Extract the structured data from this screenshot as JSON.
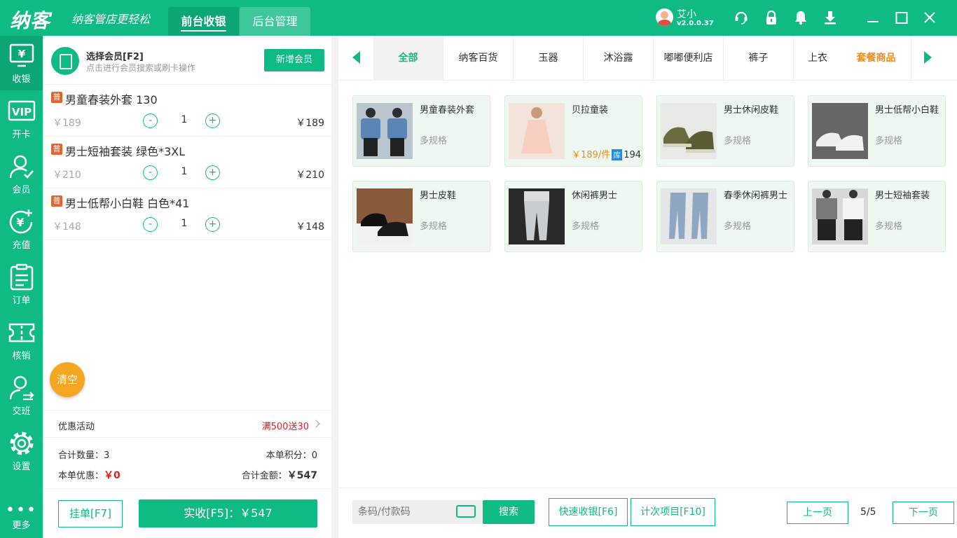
{
  "header": {
    "logo": "纳客",
    "slogan": "纳客管店更轻松",
    "tabs": [
      {
        "label": "前台收银",
        "active": true
      },
      {
        "label": "后台管理",
        "active": false
      }
    ],
    "user_name": "艾小",
    "version": "v2.0.0.37",
    "icons": [
      "headset-icon",
      "lock-icon",
      "bell-icon",
      "download-icon",
      "minimize-icon",
      "maximize-icon",
      "close-icon"
    ]
  },
  "nav": {
    "items": [
      {
        "label": "收银",
        "icon": "cashier-icon",
        "active": true
      },
      {
        "label": "开卡",
        "icon": "vip-card-icon"
      },
      {
        "label": "会员",
        "icon": "member-icon"
      },
      {
        "label": "充值",
        "icon": "recharge-icon"
      },
      {
        "label": "订单",
        "icon": "order-icon"
      },
      {
        "label": "核销",
        "icon": "ticket-icon"
      },
      {
        "label": "交班",
        "icon": "shift-icon"
      },
      {
        "label": "设置",
        "icon": "settings-icon"
      }
    ],
    "more_label": "更多"
  },
  "member": {
    "title": "选择会员[F2]",
    "subtitle": "点击进行会员搜索或刷卡操作",
    "add_label": "新增会员"
  },
  "cart": {
    "items": [
      {
        "badge": "普",
        "name": "男童春装外套 130",
        "price": "￥189",
        "qty": "1",
        "total": "￥189"
      },
      {
        "badge": "普",
        "name": "男士短袖套装 绿色*3XL",
        "price": "￥210",
        "qty": "1",
        "total": "￥210"
      },
      {
        "badge": "普",
        "name": "男士低帮小白鞋 白色*41",
        "price": "￥148",
        "qty": "1",
        "total": "￥148"
      }
    ],
    "minus": "-",
    "plus": "+",
    "clear_label": "清空",
    "promo_label": "优惠活动",
    "promo_value": "满500送30",
    "total_qty_label": "合计数量：",
    "total_qty": "3",
    "points_label": "本单积分：",
    "points": "0",
    "discount_label": "本单优惠：",
    "discount": "￥0",
    "total_amount_label": "合计金额：",
    "total_amount": "￥547",
    "hang_label": "挂单[F7]",
    "pay_label": "实收[F5]：￥547"
  },
  "categories": {
    "items": [
      "全部",
      "纳客百货",
      "玉器",
      "沐浴露",
      "嘟嘟便利店",
      "裤子",
      "上衣"
    ],
    "active": "全部",
    "combo_label": "套餐商品"
  },
  "products": [
    {
      "name": "男童春装外套",
      "spec": "多规格"
    },
    {
      "name": "贝拉童装",
      "price": "￥189/件",
      "stock_badge": "库",
      "stock": "194"
    },
    {
      "name": "男士休闲皮鞋",
      "spec": "多规格"
    },
    {
      "name": "男士低帮小白鞋",
      "spec": "多规格"
    },
    {
      "name": "男士皮鞋",
      "spec": "多规格"
    },
    {
      "name": "休闲裤男士",
      "spec": "多规格"
    },
    {
      "name": "春季休闲裤男士",
      "spec": "多规格"
    },
    {
      "name": "男士短袖套装",
      "spec": "多规格"
    }
  ],
  "bottom": {
    "scan_placeholder": "条码/付款码",
    "search_label": "搜索",
    "quick_label": "快速收银[F6]",
    "count_label": "计次项目[F10]",
    "prev_label": "上一页",
    "page": "5/5",
    "next_label": "下一页"
  },
  "colors": {
    "primary": "#0fba84",
    "accent": "#f5a623",
    "danger": "#e02020"
  }
}
